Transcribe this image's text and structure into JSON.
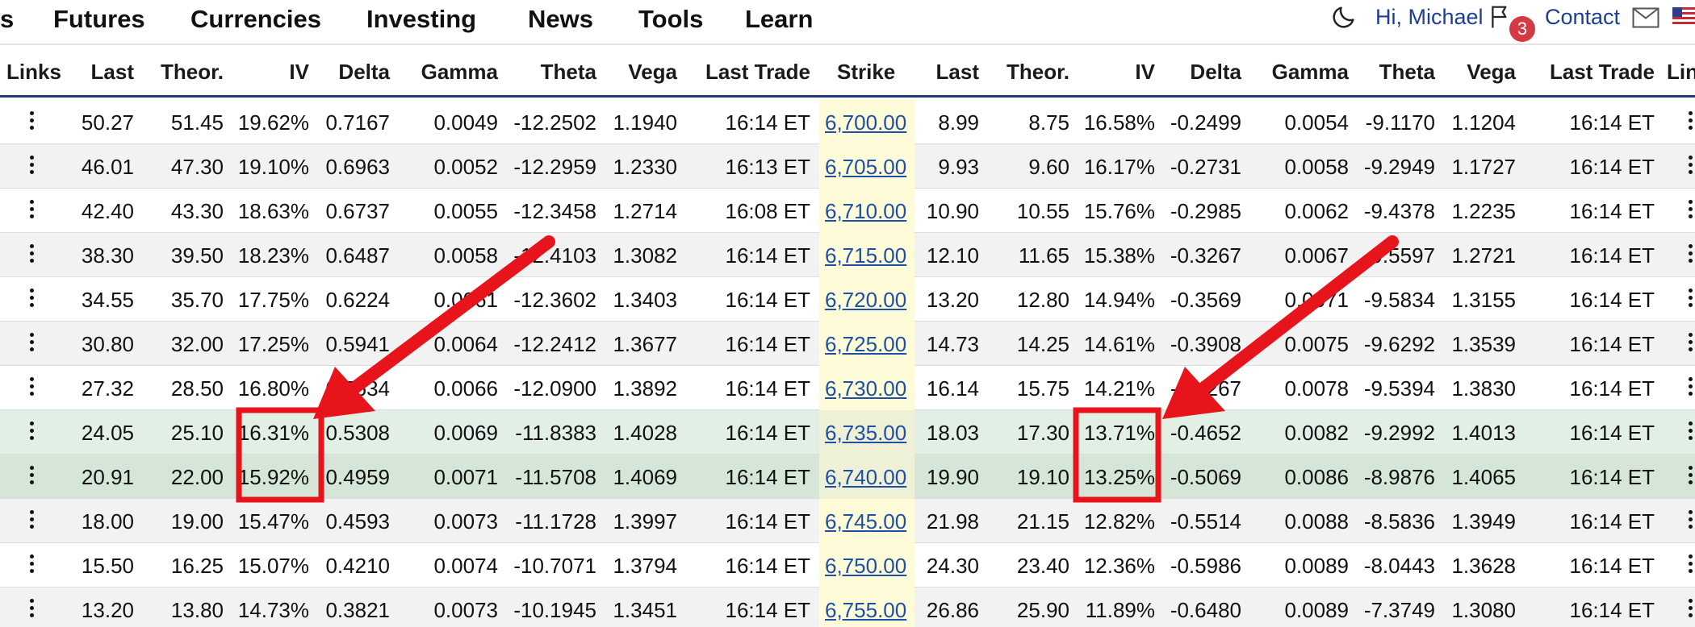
{
  "nav": {
    "items": [
      "s",
      "Futures",
      "Currencies",
      "Investing",
      "News",
      "Tools",
      "Learn"
    ],
    "greeting": "Hi, Michael",
    "notification_count": "3",
    "contact": "Contact"
  },
  "columns": {
    "calls": [
      "Links",
      "Last",
      "Theor.",
      "IV",
      "Delta",
      "Gamma",
      "Theta",
      "Vega",
      "Last Trade"
    ],
    "strike": "Strike",
    "puts": [
      "Last",
      "Theor.",
      "IV",
      "Delta",
      "Gamma",
      "Theta",
      "Vega",
      "Last Trade",
      "Lin"
    ]
  },
  "rows": [
    {
      "c": [
        "50.27",
        "51.45",
        "19.62%",
        "0.7167",
        "0.0049",
        "-12.2502",
        "1.1940",
        "16:14 ET"
      ],
      "strike": "6,700.00",
      "p": [
        "8.99",
        "8.75",
        "16.58%",
        "-0.2499",
        "0.0054",
        "-9.1170",
        "1.1204",
        "16:14 ET"
      ]
    },
    {
      "c": [
        "46.01",
        "47.30",
        "19.10%",
        "0.6963",
        "0.0052",
        "-12.2959",
        "1.2330",
        "16:13 ET"
      ],
      "strike": "6,705.00",
      "p": [
        "9.93",
        "9.60",
        "16.17%",
        "-0.2731",
        "0.0058",
        "-9.2949",
        "1.1727",
        "16:14 ET"
      ]
    },
    {
      "c": [
        "42.40",
        "43.30",
        "18.63%",
        "0.6737",
        "0.0055",
        "-12.3458",
        "1.2714",
        "16:08 ET"
      ],
      "strike": "6,710.00",
      "p": [
        "10.90",
        "10.55",
        "15.76%",
        "-0.2985",
        "0.0062",
        "-9.4378",
        "1.2235",
        "16:14 ET"
      ]
    },
    {
      "c": [
        "38.30",
        "39.50",
        "18.23%",
        "0.6487",
        "0.0058",
        "-12.4103",
        "1.3082",
        "16:14 ET"
      ],
      "strike": "6,715.00",
      "p": [
        "12.10",
        "11.65",
        "15.38%",
        "-0.3267",
        "0.0067",
        "-9.5597",
        "1.2721",
        "16:14 ET"
      ]
    },
    {
      "c": [
        "34.55",
        "35.70",
        "17.75%",
        "0.6224",
        "0.0061",
        "-12.3602",
        "1.3403",
        "16:14 ET"
      ],
      "strike": "6,720.00",
      "p": [
        "13.20",
        "12.80",
        "14.94%",
        "-0.3569",
        "0.0071",
        "-9.5834",
        "1.3155",
        "16:14 ET"
      ]
    },
    {
      "c": [
        "30.80",
        "32.00",
        "17.25%",
        "0.5941",
        "0.0064",
        "-12.2412",
        "1.3677",
        "16:14 ET"
      ],
      "strike": "6,725.00",
      "p": [
        "14.73",
        "14.25",
        "14.61%",
        "-0.3908",
        "0.0075",
        "-9.6292",
        "1.3539",
        "16:14 ET"
      ]
    },
    {
      "c": [
        "27.32",
        "28.50",
        "16.80%",
        "0.5634",
        "0.0066",
        "-12.0900",
        "1.3892",
        "16:14 ET"
      ],
      "strike": "6,730.00",
      "p": [
        "16.14",
        "15.75",
        "14.21%",
        "-0.4267",
        "0.0078",
        "-9.5394",
        "1.3830",
        "16:14 ET"
      ]
    },
    {
      "c": [
        "24.05",
        "25.10",
        "16.31%",
        "0.5308",
        "0.0069",
        "-11.8383",
        "1.4028",
        "16:14 ET"
      ],
      "strike": "6,735.00",
      "p": [
        "18.03",
        "17.30",
        "13.71%",
        "-0.4652",
        "0.0082",
        "-9.2992",
        "1.4013",
        "16:14 ET"
      ]
    },
    {
      "c": [
        "20.91",
        "22.00",
        "15.92%",
        "0.4959",
        "0.0071",
        "-11.5708",
        "1.4069",
        "16:14 ET"
      ],
      "strike": "6,740.00",
      "p": [
        "19.90",
        "19.10",
        "13.25%",
        "-0.5069",
        "0.0086",
        "-8.9876",
        "1.4065",
        "16:14 ET"
      ]
    },
    {
      "c": [
        "18.00",
        "19.00",
        "15.47%",
        "0.4593",
        "0.0073",
        "-11.1728",
        "1.3997",
        "16:14 ET"
      ],
      "strike": "6,745.00",
      "p": [
        "21.98",
        "21.15",
        "12.82%",
        "-0.5514",
        "0.0088",
        "-8.5836",
        "1.3949",
        "16:14 ET"
      ]
    },
    {
      "c": [
        "15.50",
        "16.25",
        "15.07%",
        "0.4210",
        "0.0074",
        "-10.7071",
        "1.3794",
        "16:14 ET"
      ],
      "strike": "6,750.00",
      "p": [
        "24.30",
        "23.40",
        "12.36%",
        "-0.5986",
        "0.0089",
        "-8.0443",
        "1.3628",
        "16:14 ET"
      ]
    },
    {
      "c": [
        "13.20",
        "13.80",
        "14.73%",
        "0.3821",
        "0.0073",
        "-10.1945",
        "1.3451",
        "16:14 ET"
      ],
      "strike": "6,755.00",
      "p": [
        "26.86",
        "25.90",
        "11.89%",
        "-0.6480",
        "0.0089",
        "-7.3749",
        "1.3080",
        "16:14 ET"
      ]
    }
  ],
  "colors": {
    "annotation": "#e8141b",
    "link": "#1f4fa6",
    "header_rule": "#1f3a7a",
    "strike_highlight": "#fdfbd8",
    "itm_row": "#e2efe5"
  },
  "annotations": {
    "highlighted_values": [
      "16.31%",
      "15.92%",
      "13.71%",
      "13.25%"
    ]
  }
}
